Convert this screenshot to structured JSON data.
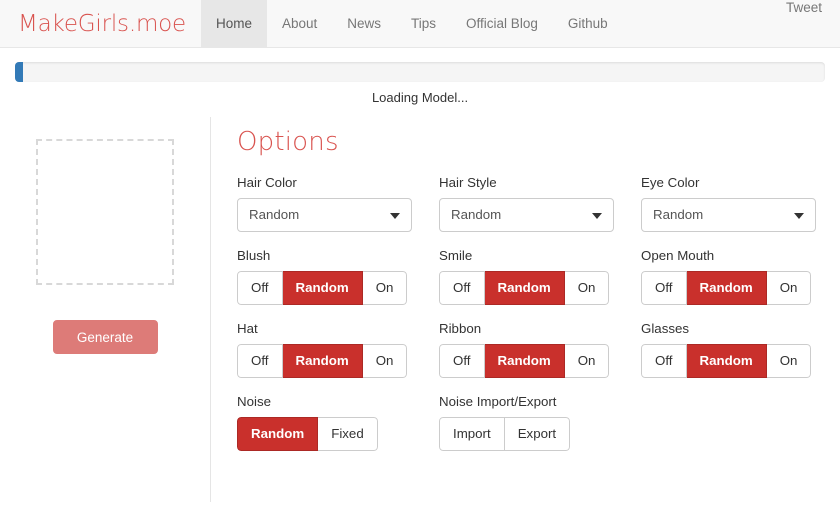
{
  "navbar": {
    "brand": "MakeGirls.moe",
    "links": [
      {
        "label": "Home",
        "active": true
      },
      {
        "label": "About",
        "active": false
      },
      {
        "label": "News",
        "active": false
      },
      {
        "label": "Tips",
        "active": false
      },
      {
        "label": "Official Blog",
        "active": false
      },
      {
        "label": "Github",
        "active": false
      }
    ],
    "tweet": "Tweet"
  },
  "progress": {
    "percent": 1,
    "status_text": "Loading Model..."
  },
  "left_panel": {
    "generate_label": "Generate"
  },
  "options": {
    "title": "Options",
    "selects": [
      {
        "label": "Hair Color",
        "value": "Random",
        "options": [
          "Random"
        ]
      },
      {
        "label": "Hair Style",
        "value": "Random",
        "options": [
          "Random"
        ]
      },
      {
        "label": "Eye Color",
        "value": "Random",
        "options": [
          "Random"
        ]
      }
    ],
    "toggles": [
      {
        "label": "Blush",
        "buttons": [
          "Off",
          "Random",
          "On"
        ],
        "selected": 1
      },
      {
        "label": "Smile",
        "buttons": [
          "Off",
          "Random",
          "On"
        ],
        "selected": 1
      },
      {
        "label": "Open Mouth",
        "buttons": [
          "Off",
          "Random",
          "On"
        ],
        "selected": 1
      },
      {
        "label": "Hat",
        "buttons": [
          "Off",
          "Random",
          "On"
        ],
        "selected": 1
      },
      {
        "label": "Ribbon",
        "buttons": [
          "Off",
          "Random",
          "On"
        ],
        "selected": 1
      },
      {
        "label": "Glasses",
        "buttons": [
          "Off",
          "Random",
          "On"
        ],
        "selected": 1
      },
      {
        "label": "Noise",
        "buttons": [
          "Random",
          "Fixed"
        ],
        "selected": 0
      },
      {
        "label": "Noise Import/Export",
        "buttons": [
          "Import",
          "Export"
        ],
        "selected": -1
      }
    ]
  },
  "colors": {
    "brand_red": "#d9534f",
    "active_red": "#c9302c",
    "progress_blue": "#337ab7",
    "navbar_bg": "#f8f8f8",
    "navbar_active_bg": "#e7e7e7"
  }
}
